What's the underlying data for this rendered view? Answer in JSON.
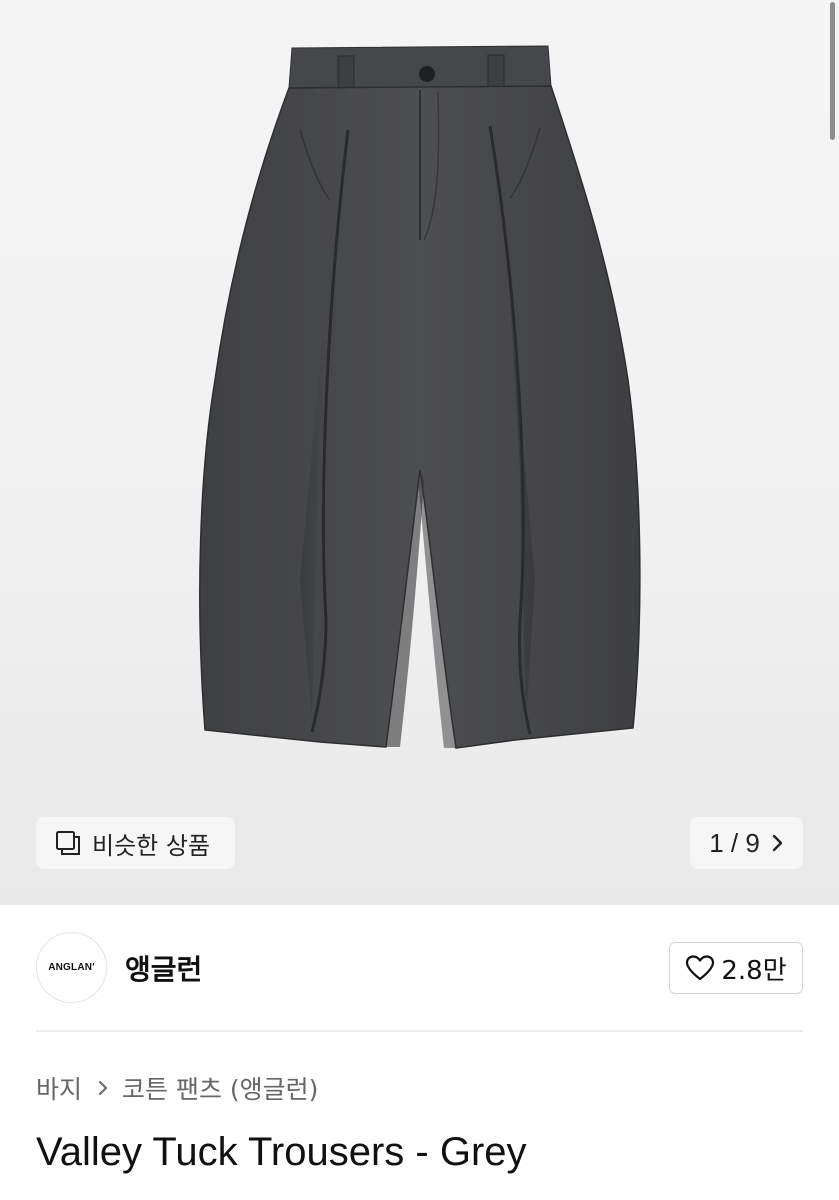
{
  "gallery": {
    "similar_button_label": "비슷한 상품",
    "similar_icon": "similar-items-icon",
    "pager_text": "1 / 9",
    "pager_icon": "chevron-right-icon",
    "image_description_alt": "Valley Tuck Trousers - Grey"
  },
  "brand": {
    "logo_text": "ANGLAN'",
    "name": "앵글런",
    "like_icon": "heart-outline-icon",
    "like_count": "2.8만"
  },
  "breadcrumb": {
    "category": "바지",
    "subcategory": "코튼 팬츠 (앵글런)"
  },
  "product": {
    "title": "Valley Tuck Trousers - Grey"
  },
  "colors": {
    "trousers": "#4a4b4d",
    "gallery_bg": "#f2f2f2",
    "button_bg": "#f6f6f6",
    "text_primary": "#111111",
    "text_secondary": "#666666"
  }
}
